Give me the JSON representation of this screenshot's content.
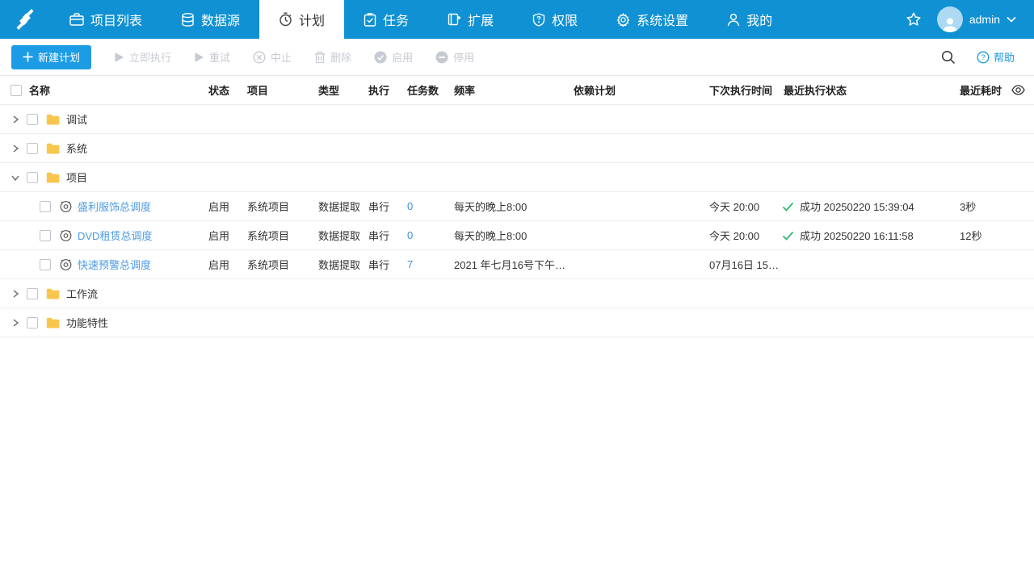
{
  "colors": {
    "nav_bg": "#1091d3",
    "primary_button": "#1c9ce4",
    "link_blue": "#4c9ae2",
    "folder_yellow": "#f8c64e",
    "success_green": "#2eb872",
    "disabled_gray": "#c6cad2"
  },
  "icons": {
    "help_glyph": "?"
  },
  "nav": {
    "logo": "s-logo-icon",
    "user": "admin",
    "tabs": [
      {
        "label": "项目列表",
        "icon": "briefcase-icon",
        "active": false
      },
      {
        "label": "数据源",
        "icon": "database-icon",
        "active": false
      },
      {
        "label": "计划",
        "icon": "stopwatch-icon",
        "active": true
      },
      {
        "label": "任务",
        "icon": "clipboard-check-icon",
        "active": false
      },
      {
        "label": "扩展",
        "icon": "extension-icon",
        "active": false
      },
      {
        "label": "权限",
        "icon": "shield-question-icon",
        "active": false
      },
      {
        "label": "系统设置",
        "icon": "gear-icon",
        "active": false
      },
      {
        "label": "我的",
        "icon": "user-icon",
        "active": false
      }
    ]
  },
  "toolbar": {
    "new_plan": "新建计划",
    "run_now": "立即执行",
    "retry": "重试",
    "abort": "中止",
    "delete": "删除",
    "enable": "启用",
    "disable": "停用",
    "help": "帮助"
  },
  "table": {
    "headers": [
      "名称",
      "状态",
      "项目",
      "类型",
      "执行",
      "任务数",
      "频率",
      "依赖计划",
      "下次执行时间",
      "最近执行状态",
      "最近耗时"
    ],
    "rows": [
      {
        "kind": "folder",
        "name": "调试",
        "expanded": false
      },
      {
        "kind": "folder",
        "name": "系统",
        "expanded": false
      },
      {
        "kind": "folder",
        "name": "项目",
        "expanded": true
      },
      {
        "kind": "plan",
        "name": "盛利服饰总调度",
        "status": "启用",
        "project": "系统项目",
        "type": "数据提取",
        "exec": "串行",
        "tasks": "0",
        "freq": "每天的晚上8:00",
        "depends": "",
        "next": "今天 20:00",
        "last_ok": true,
        "last_status": "成功 20250220 15:39:04",
        "duration": "3秒"
      },
      {
        "kind": "plan",
        "name": "DVD租赁总调度",
        "status": "启用",
        "project": "系统项目",
        "type": "数据提取",
        "exec": "串行",
        "tasks": "0",
        "freq": "每天的晚上8:00",
        "depends": "",
        "next": "今天 20:00",
        "last_ok": true,
        "last_status": "成功 20250220 16:11:58",
        "duration": "12秒"
      },
      {
        "kind": "plan",
        "name": "快速预警总调度",
        "status": "启用",
        "project": "系统项目",
        "type": "数据提取",
        "exec": "串行",
        "tasks": "7",
        "freq": "2021 年七月16号下午3:...",
        "depends": "",
        "next": "07月16日 15:...",
        "last_ok": false,
        "last_status": "",
        "duration": ""
      },
      {
        "kind": "folder",
        "name": "工作流",
        "expanded": false
      },
      {
        "kind": "folder",
        "name": "功能特性",
        "expanded": false
      }
    ]
  }
}
